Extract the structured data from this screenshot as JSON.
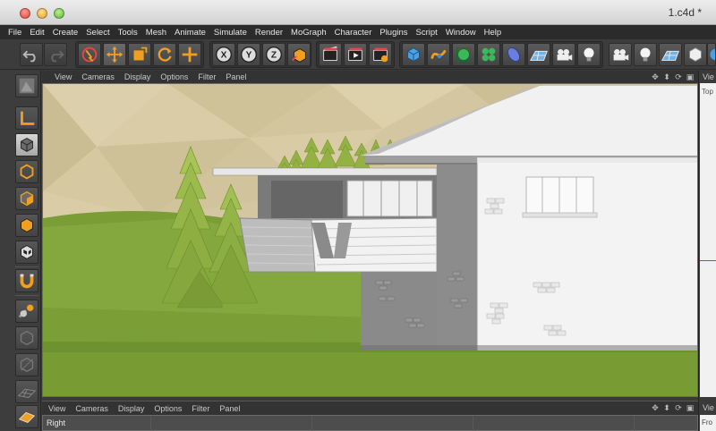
{
  "window": {
    "title": "1.c4d *"
  },
  "menu": [
    "File",
    "Edit",
    "Create",
    "Select",
    "Tools",
    "Mesh",
    "Animate",
    "Simulate",
    "Render",
    "MoGraph",
    "Character",
    "Plugins",
    "Script",
    "Window",
    "Help"
  ],
  "toolbar": {
    "axis_x": "X",
    "axis_y": "Y",
    "axis_z": "Z"
  },
  "viewport_top": {
    "menu": [
      "View",
      "Cameras",
      "Display",
      "Options",
      "Filter",
      "Panel"
    ]
  },
  "viewport_bottom": {
    "menu": [
      "View",
      "Cameras",
      "Display",
      "Options",
      "Filter",
      "Panel"
    ],
    "label": "Right"
  },
  "right_panel": {
    "header1": "Vie",
    "label1": "Top",
    "header2": "Vie",
    "label2": "Fro"
  },
  "colors": {
    "accent_orange": "#f0a020",
    "sky": "#d7cba4",
    "grass": "#7ea23a",
    "tree": "#8fae3e",
    "wall": "#f2f2f2"
  }
}
